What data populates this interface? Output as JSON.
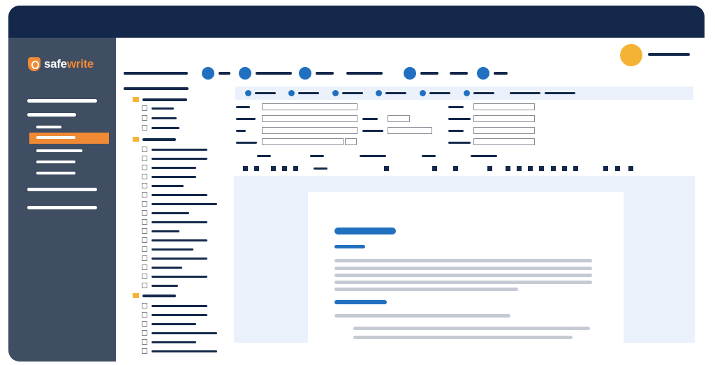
{
  "app": {
    "logo_text_main": "safe",
    "logo_text_accent": "write"
  },
  "colors": {
    "navy": "#13284a",
    "sidebar": "#404e63",
    "accent_orange": "#f08a35",
    "avatar_yellow": "#f5b335",
    "primary_blue": "#2170c0",
    "panel_bg": "#eaf1fb",
    "placeholder_gray": "#c5cad3"
  },
  "icons": {
    "logo": "safewrite-shield-icon",
    "tree_folder": "folder-icon",
    "tree_item": "checkbox-icon",
    "avatar": "user-avatar-icon",
    "step": "step-circle-icon"
  },
  "sidebar": {
    "selected_index": 2
  }
}
